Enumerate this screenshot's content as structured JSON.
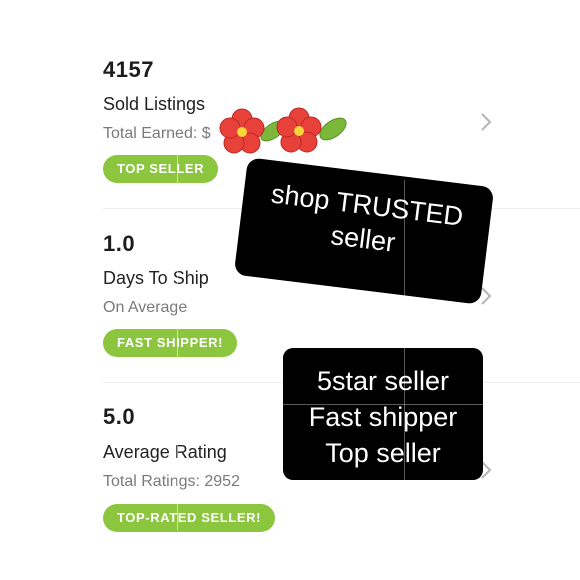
{
  "stats": [
    {
      "value": "4157",
      "title": "Sold Listings",
      "subtitle": "Total Earned: $",
      "badge": "TOP SELLER"
    },
    {
      "value": "1.0",
      "title": "Days To Ship",
      "subtitle": "On Average",
      "badge": "FAST SHIPPER!"
    },
    {
      "value": "5.0",
      "title": "Average Rating",
      "subtitle": "Total Ratings: 2952",
      "badge": "TOP-RATED SELLER!"
    }
  ],
  "stickers": {
    "trusted": [
      "shop TRUSTED",
      "seller"
    ],
    "summary": [
      "5star seller",
      "Fast shipper",
      "Top seller"
    ]
  },
  "colors": {
    "badge_green": "#8cc63f",
    "sticker_bg": "#000000",
    "flower_red": "#e8413a",
    "leaf_green": "#7bb83a"
  },
  "icons": [
    "chevron-right-icon",
    "flower-icon",
    "leaf-icon"
  ]
}
